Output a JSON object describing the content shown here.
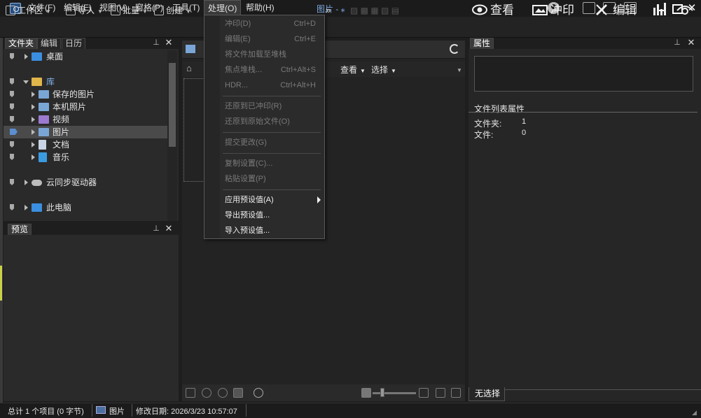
{
  "menu": {
    "items": [
      "文件(F)",
      "编辑(E)",
      "视图(V)",
      "窗格(P)",
      "工具(T)",
      "处理(O)",
      "帮助(H)"
    ],
    "window_title": "图片 - ⁎"
  },
  "toolbar": {
    "workspace": "工作区",
    "import": "导入",
    "batch": "批量",
    "create": "创建",
    "more": "»",
    "modes": [
      "查看",
      "冲印",
      "编辑"
    ]
  },
  "folders_panel": {
    "tabs": [
      "文件夹",
      "编辑",
      "日历"
    ],
    "tree": [
      {
        "label": "桌面"
      },
      {
        "label": "库"
      },
      {
        "label": "保存的图片"
      },
      {
        "label": "本机照片"
      },
      {
        "label": "视频"
      },
      {
        "label": "图片"
      },
      {
        "label": "文档"
      },
      {
        "label": "音乐"
      },
      {
        "label": "云同步驱动器"
      },
      {
        "label": "此电脑"
      }
    ]
  },
  "preview_panel": {
    "tab": "预览"
  },
  "content": {
    "nav": {
      "view": "查看",
      "select": "选择"
    }
  },
  "context_menu": {
    "items": [
      {
        "label": "冲印(D)",
        "shortcut": "Ctrl+D",
        "enabled": false
      },
      {
        "label": "编辑(E)",
        "shortcut": "Ctrl+E",
        "enabled": false
      },
      {
        "label": "将文件加载至堆栈",
        "shortcut": "",
        "enabled": false
      },
      {
        "label": "焦点堆栈...",
        "shortcut": "Ctrl+Alt+S",
        "enabled": false
      },
      {
        "label": "HDR...",
        "shortcut": "Ctrl+Alt+H",
        "enabled": false
      },
      {
        "label": "还原到已冲印(R)",
        "shortcut": "",
        "enabled": false
      },
      {
        "label": "还原到原始文件(O)",
        "shortcut": "",
        "enabled": false
      },
      {
        "label": "提交更改(G)",
        "shortcut": "",
        "enabled": false
      },
      {
        "label": "复制设置(C)...",
        "shortcut": "",
        "enabled": false
      },
      {
        "label": "粘贴设置(P)",
        "shortcut": "",
        "enabled": false
      },
      {
        "label": "应用预设值(A)",
        "shortcut": "",
        "enabled": true
      },
      {
        "label": "导出预设值...",
        "shortcut": "",
        "enabled": true
      },
      {
        "label": "导入预设值...",
        "shortcut": "",
        "enabled": true
      }
    ]
  },
  "properties_panel": {
    "tab": "属性",
    "section": "文件列表属性",
    "rows": [
      {
        "key": "文件夹:",
        "value": "1"
      },
      {
        "key": "文件:",
        "value": "0"
      }
    ],
    "bottom_tab": "无选择"
  },
  "status_bar": {
    "total": "总计 1 个项目 (0 字节)",
    "location": "图片",
    "modified": "修改日期: 2026/3/23 10:57:07"
  },
  "colors": {
    "background": "#1e1e1e",
    "panel": "#2a2a2a",
    "accent_blue": "#5a8fd0",
    "disabled_text": "#7a7a7a"
  }
}
